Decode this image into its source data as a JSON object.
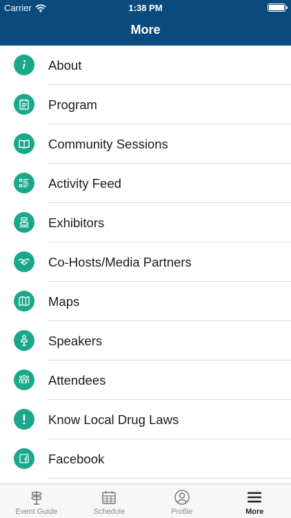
{
  "status_bar": {
    "carrier": "Carrier",
    "time": "1:38 PM"
  },
  "header": {
    "title": "More"
  },
  "accent_color": "#1aa88a",
  "header_color": "#0b4a7d",
  "menu": [
    {
      "label": "About",
      "icon": "info-icon"
    },
    {
      "label": "Program",
      "icon": "program-icon"
    },
    {
      "label": "Community Sessions",
      "icon": "book-icon"
    },
    {
      "label": "Activity Feed",
      "icon": "list-icon"
    },
    {
      "label": "Exhibitors",
      "icon": "booth-icon"
    },
    {
      "label": "Co-Hosts/Media Partners",
      "icon": "handshake-icon"
    },
    {
      "label": "Maps",
      "icon": "map-icon"
    },
    {
      "label": "Speakers",
      "icon": "speaker-icon"
    },
    {
      "label": "Attendees",
      "icon": "attendees-icon"
    },
    {
      "label": "Know Local Drug Laws",
      "icon": "exclamation-icon"
    },
    {
      "label": "Facebook",
      "icon": "facebook-icon"
    }
  ],
  "tabs": [
    {
      "label": "Event Guide",
      "icon": "signpost-icon"
    },
    {
      "label": "Schedule",
      "icon": "calendar-icon"
    },
    {
      "label": "Profile",
      "icon": "profile-icon"
    },
    {
      "label": "More",
      "icon": "hamburger-icon",
      "active": true
    }
  ]
}
